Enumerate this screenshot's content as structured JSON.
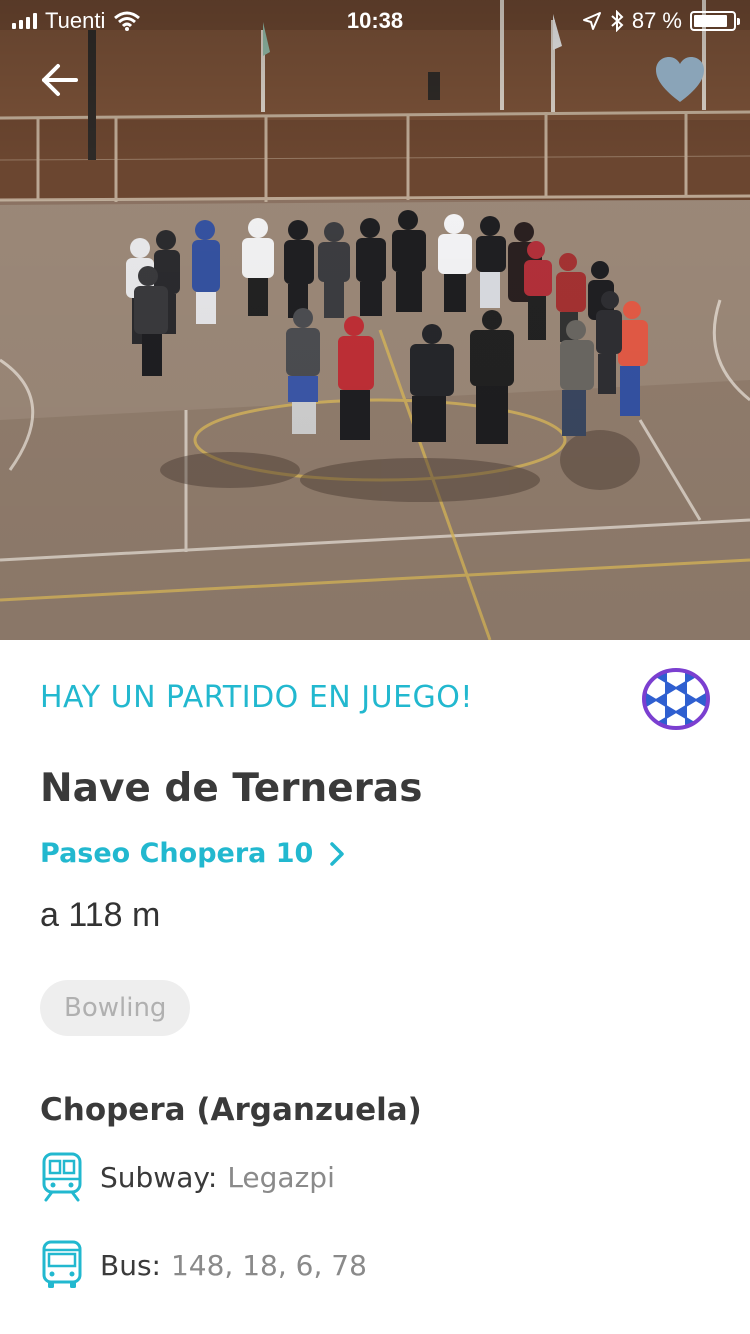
{
  "status_bar": {
    "carrier": "Tuenti",
    "time": "10:38",
    "battery_text": "87 %",
    "battery_level": 0.87
  },
  "icons": {
    "back": "arrow-left-icon",
    "favorite": "heart-icon",
    "sport": "soccer-ball-icon",
    "address_chevron": "chevron-right-icon",
    "subway": "train-icon",
    "bus": "bus-icon"
  },
  "colors": {
    "accent": "#22b8cf",
    "ball": "#7b3fd0",
    "favorite_heart": "#8aa4b8",
    "text_dark": "#3a3a3a",
    "text_muted": "#8a8a8a",
    "chip_bg": "#eeeeee"
  },
  "venue": {
    "match_banner": "HAY UN PARTIDO EN JUEGO!",
    "name": "Nave de Terneras",
    "address": "Paseo Chopera 10",
    "distance": "a 118 m",
    "category": "Bowling"
  },
  "area": {
    "title": "Chopera (Arganzuela)",
    "subway_label": "Subway:",
    "subway_value": "Legazpi",
    "bus_label": "Bus:",
    "bus_value": "148, 18, 6, 78"
  }
}
